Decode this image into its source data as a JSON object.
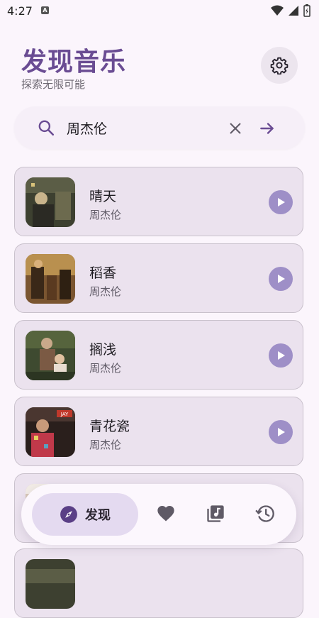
{
  "status": {
    "time": "4:27",
    "app_icon": "A"
  },
  "header": {
    "title": "发现音乐",
    "subtitle": "探索无限可能",
    "settings_icon": "gear-icon"
  },
  "search": {
    "value": "周杰伦",
    "placeholder": ""
  },
  "songs": [
    {
      "title": "晴天",
      "artist": "周杰伦"
    },
    {
      "title": "稻香",
      "artist": "周杰伦"
    },
    {
      "title": "搁浅",
      "artist": "周杰伦"
    },
    {
      "title": "青花瓷",
      "artist": "周杰伦"
    },
    {
      "title": "",
      "artist": ""
    },
    {
      "title": "",
      "artist": ""
    }
  ],
  "album_badge": "JAY",
  "nav": {
    "discover_label": "发现",
    "items": [
      "compass-icon",
      "heart-icon",
      "music-library-icon",
      "history-icon"
    ]
  },
  "colors": {
    "accent": "#6a4c93",
    "card": "#ebe2ee",
    "play": "#9e8fc7",
    "nav_active": "#e4daf0"
  }
}
